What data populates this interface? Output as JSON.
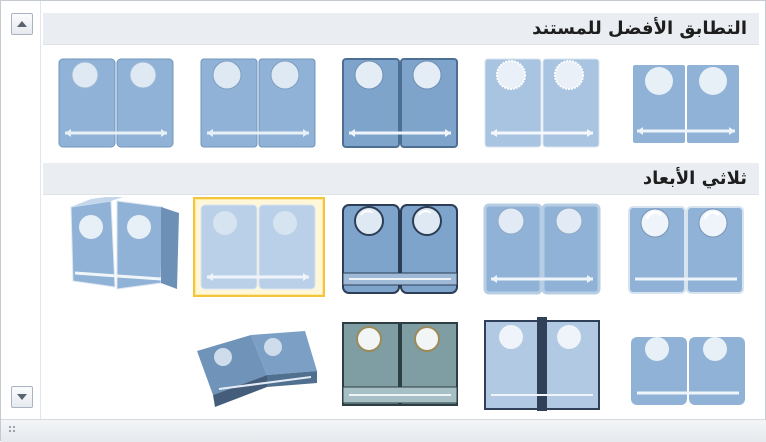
{
  "sections": [
    {
      "title": "التطابق الأفضل للمستند",
      "items": [
        "style-1",
        "style-2",
        "style-3",
        "style-4",
        "style-5"
      ]
    },
    {
      "title": "ثلاثي الأبعاد",
      "items": [
        "3d-1",
        "3d-2",
        "3d-3",
        "3d-4",
        "3d-5",
        "3d-6",
        "3d-7",
        "3d-8",
        "3d-9"
      ]
    }
  ],
  "selected_item": "3d-4",
  "colors": {
    "accent_selection": "#f2c53b",
    "tile_fill": "#8fb2d6",
    "header_bg": "#eaedf1"
  },
  "icons": {
    "scroll_up": "triangle-up-icon",
    "scroll_down": "triangle-down-icon",
    "resize_grip": "resize-grip-icon"
  }
}
